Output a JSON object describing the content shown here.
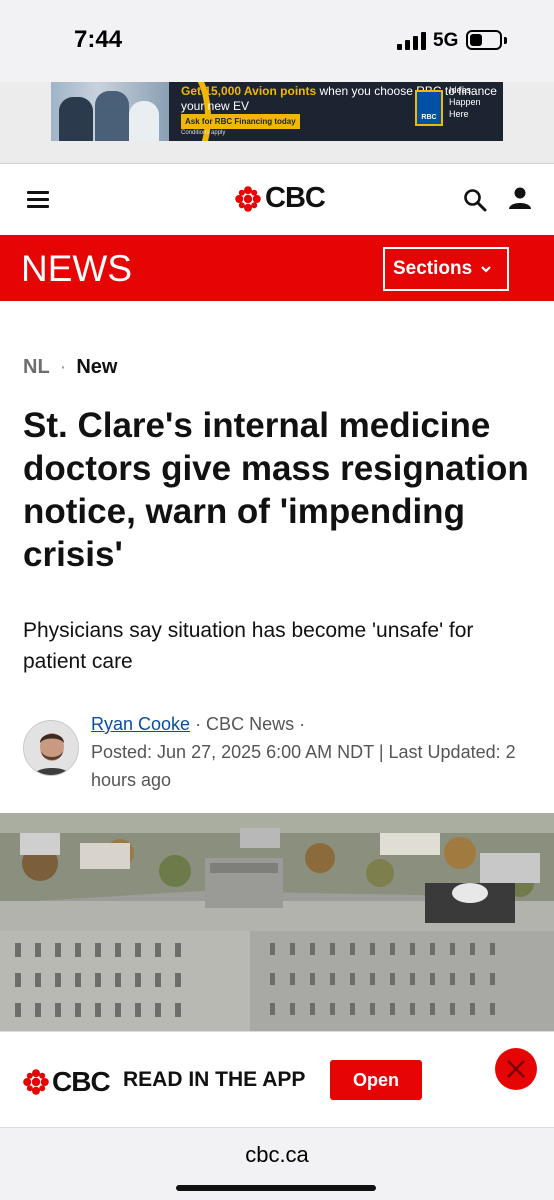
{
  "status_bar": {
    "time": "7:44",
    "network": "5G"
  },
  "ad": {
    "headline_highlight": "Get 15,000 Avion points",
    "headline_rest": " when you choose RBC to finance your new EV",
    "cta": "Ask for RBC Financing today",
    "conditions": "Conditions apply",
    "brand": "RBC",
    "tagline": "Ideas Happen Here",
    "accent_color": "#f2b705"
  },
  "header": {
    "logo_text": "CBC",
    "menu_icon": "hamburger-menu-icon",
    "search_icon": "search-icon",
    "account_icon": "account-icon"
  },
  "news_bar": {
    "title": "NEWS",
    "sections_label": "Sections",
    "color": "#e60505"
  },
  "article": {
    "region": "NL",
    "separator": "·",
    "tag": "New",
    "headline": "St. Clare's internal medicine doctors give mass resignation notice, warn of 'impending crisis'",
    "deck": "Physicians say situation has become 'unsafe' for patient care",
    "byline": {
      "author": "Ryan Cooke",
      "outlet": " · CBC News ·",
      "posted": "Posted: Jun 27, 2025 6:00 AM NDT | Last Updated: 2 hours ago"
    }
  },
  "app_banner": {
    "logo_text": "CBC",
    "label": "READ IN THE APP",
    "open_label": "Open"
  },
  "browser": {
    "url": "cbc.ca"
  }
}
